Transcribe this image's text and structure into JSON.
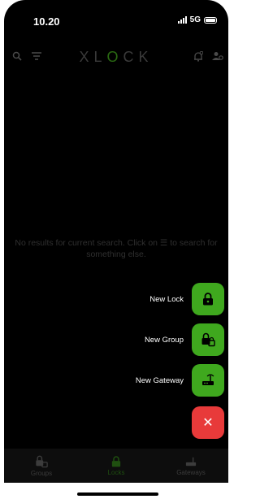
{
  "status": {
    "time": "10.20",
    "network": "5G"
  },
  "header": {
    "logo_left": "XL",
    "logo_o": "O",
    "logo_right": "CK",
    "search_icon": "search-icon",
    "filter_icon": "filter-icon",
    "bell_icon": "bell-icon",
    "user_settings_icon": "user-settings-icon"
  },
  "main": {
    "empty_message": "No results for current search. Click on ☰ to search for something else."
  },
  "fab_menu": {
    "items": [
      {
        "label": "New Lock",
        "icon": "lock-icon"
      },
      {
        "label": "New Group",
        "icon": "group-lock-icon"
      },
      {
        "label": "New Gateway",
        "icon": "gateway-icon"
      }
    ],
    "close_symbol": "✕"
  },
  "bottom_nav": {
    "items": [
      {
        "label": "Groups",
        "icon": "group-lock-icon"
      },
      {
        "label": "Locks",
        "icon": "lock-icon",
        "active": true
      },
      {
        "label": "Gateways",
        "icon": "gateway-icon"
      }
    ]
  },
  "colors": {
    "accent_green": "#3fa81e",
    "close_red": "#e83a3a",
    "background": "#000000"
  }
}
